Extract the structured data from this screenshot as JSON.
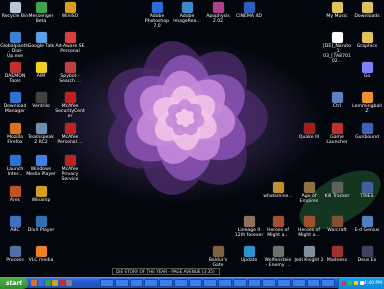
{
  "desktop_icons": [
    {
      "label": "Recycle Bin",
      "icon": "recycle-bin-icon",
      "color": "#b8c8d8"
    },
    {
      "label": "Messenger Beta",
      "icon": "messenger-icon",
      "color": "#3fa34d"
    },
    {
      "label": "WinISO",
      "icon": "winiso-icon",
      "color": "#d6a020"
    },
    {
      "label": "Adobe Photoshop 7.0",
      "icon": "photoshop-icon",
      "color": "#2b6bd6"
    },
    {
      "label": "Adobe ImageRea...",
      "icon": "imageready-icon",
      "color": "#3a8ad0"
    },
    {
      "label": "Apophysis 2.02",
      "icon": "apophysis-icon",
      "color": "#b0408a"
    },
    {
      "label": "CINEMA 4D",
      "icon": "cinema4d-icon",
      "color": "#2d5dbd"
    },
    {
      "label": "My Music",
      "icon": "my-music-icon",
      "color": "#e0c060"
    },
    {
      "label": "Downloads",
      "icon": "downloads-folder-icon",
      "color": "#e0c060"
    },
    {
      "label": "Globalpanth... Dial-Up.exe",
      "icon": "dialup-icon",
      "color": "#4080d0"
    },
    {
      "label": "Google Talk",
      "icon": "google-talk-icon",
      "color": "#5aa0e8"
    },
    {
      "label": "Ad-Aware SE Personal",
      "icon": "adaware-icon",
      "color": "#d84040"
    },
    {
      "label": "[DE]_Naruto_1 03_[7A870102...",
      "icon": "video-file-icon",
      "color": "#ffffff"
    },
    {
      "label": "Graphics",
      "icon": "graphics-folder-icon",
      "color": "#e0c060"
    },
    {
      "label": "DAEMON Tools",
      "icon": "daemon-tools-icon",
      "color": "#c03030"
    },
    {
      "label": "AIM",
      "icon": "aim-icon",
      "color": "#f0d020"
    },
    {
      "label": "Spybot - Search ...",
      "icon": "spybot-icon",
      "color": "#c04040"
    },
    {
      "label": "Go",
      "icon": "go-icon",
      "color": "#8080ff"
    },
    {
      "label": "Download Manager",
      "icon": "download-manager-icon",
      "color": "#3070d0"
    },
    {
      "label": "Ventrilo",
      "icon": "ventrilo-icon",
      "color": "#404040"
    },
    {
      "label": "McAfee SecurityCenter",
      "icon": "mcafee-icon",
      "color": "#c02020"
    },
    {
      "label": "Ctrl",
      "icon": "ctrl-icon",
      "color": "#6080c0"
    },
    {
      "label": "Lemmingball Z",
      "icon": "lemmingball-icon",
      "color": "#f09030"
    },
    {
      "label": "Mozilla Firefox",
      "icon": "firefox-icon",
      "color": "#e07020"
    },
    {
      "label": "Teamspeak 2 RC2",
      "icon": "teamspeak-icon",
      "color": "#7090b0"
    },
    {
      "label": "McAfee Personal ...",
      "icon": "mcafee-personal-icon",
      "color": "#c02020"
    },
    {
      "label": "Quake III",
      "icon": "quake-icon",
      "color": "#a02020"
    },
    {
      "label": "Game Launcher",
      "icon": "game-launcher-icon",
      "color": "#c03030"
    },
    {
      "label": "Gunbound",
      "icon": "gunbound-icon",
      "color": "#4060c0"
    },
    {
      "label": "Launch Inter...",
      "icon": "ie-icon",
      "color": "#3070d0"
    },
    {
      "label": "Windows Media Player",
      "icon": "wmp-icon",
      "color": "#4080e0"
    },
    {
      "label": "McAfee Privacy Service",
      "icon": "mcafee-privacy-icon",
      "color": "#c02020"
    },
    {
      "label": "whatsmine...",
      "icon": "whatsmine-icon",
      "color": "#c09030"
    },
    {
      "label": "Age of Empires",
      "icon": "age-of-empires-icon",
      "color": "#907040"
    },
    {
      "label": "Kill Tracker",
      "icon": "kill-tracker-icon",
      "color": "#606060"
    },
    {
      "label": "TRIES",
      "icon": "tries-icon",
      "color": "#4060a0"
    },
    {
      "label": "Ares",
      "icon": "ares-icon",
      "color": "#c05030"
    },
    {
      "label": "Winamp",
      "icon": "winamp-icon",
      "color": "#d0a020"
    },
    {
      "label": "ABC",
      "icon": "abc-icon",
      "color": "#4070c0"
    },
    {
      "label": "DivX Player",
      "icon": "divx-icon",
      "color": "#3070b0"
    },
    {
      "label": "Lineage II 12th forever",
      "icon": "lineage-icon",
      "color": "#907060"
    },
    {
      "label": "Heroes of Might a...",
      "icon": "heroes-icon",
      "color": "#a05030"
    },
    {
      "label": "Heroes of Might a...",
      "icon": "heroes2-icon",
      "color": "#a05030"
    },
    {
      "label": "Warcraft",
      "icon": "warcraft-icon",
      "color": "#805030"
    },
    {
      "label": "E-d Genius",
      "icon": "genius-icon",
      "color": "#5080c0"
    },
    {
      "label": "Process",
      "icon": "process-icon",
      "color": "#5070a0"
    },
    {
      "label": "VLC media",
      "icon": "vlc-icon",
      "color": "#f08020"
    },
    {
      "label": "Baldur's Gate",
      "icon": "baldurs-gate-icon",
      "color": "#806040"
    },
    {
      "label": "Update",
      "icon": "update-icon",
      "color": "#3090d0"
    },
    {
      "label": "Wolfenstein - Enemy ...",
      "icon": "wolfenstein-icon",
      "color": "#707070"
    },
    {
      "label": "Jedi Knight 2",
      "icon": "jedi-knight-icon",
      "color": "#8090a0"
    },
    {
      "label": "Madness",
      "icon": "madness-icon",
      "color": "#a03030"
    },
    {
      "label": "Deus Ex",
      "icon": "deus-ex-icon",
      "color": "#404060"
    }
  ],
  "music_bar": {
    "text": "DIE   STORY OF THE YEAR - PAGE AVENUE (3:35)"
  },
  "taskbar": {
    "start_label": "start",
    "clock": "4:40 PM",
    "task_count": 16
  },
  "quicklaunch_colors": [
    "#e07020",
    "#3070d0",
    "#40a040",
    "#d0a020",
    "#c03030",
    "#808080"
  ],
  "tray_colors": [
    "#e03030",
    "#40c040",
    "#f0d020",
    "#ffffff"
  ],
  "wallpaper": {
    "petal_colors": [
      "#f2c6e8",
      "#c78ad9",
      "#8a55b5",
      "#4b2a6a"
    ],
    "subject": "rose"
  }
}
